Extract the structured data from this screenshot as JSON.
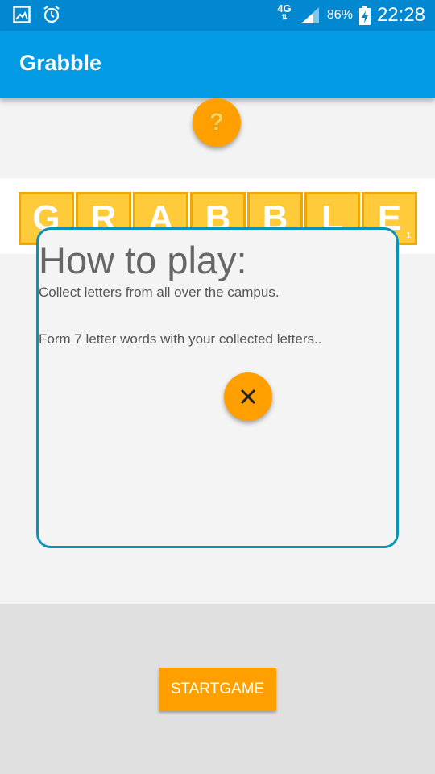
{
  "status_bar": {
    "network_type": "4G",
    "battery_percent": "86%",
    "time": "22:28",
    "left_icons": [
      "gallery-icon",
      "alarm-icon"
    ]
  },
  "app_bar": {
    "title": "Grabble"
  },
  "help_button": {
    "icon": "question-mark-icon",
    "glyph": "?"
  },
  "logo": {
    "tiles": [
      "G",
      "R",
      "A",
      "B",
      "B",
      "L",
      "E"
    ],
    "last_tile_subscript": "1"
  },
  "dialog": {
    "title": "How to play:",
    "line1": "Collect letters from all over the campus.",
    "line2": "Form 7 letter words with your collected letters..",
    "close_icon": "close-icon"
  },
  "start_button": {
    "label": "STARTGAME"
  },
  "colors": {
    "status_bar": "#0288d1",
    "app_bar": "#039be5",
    "accent": "#ffa000",
    "dialog_border": "#0a93b8",
    "tile": "#ffcb3a"
  }
}
